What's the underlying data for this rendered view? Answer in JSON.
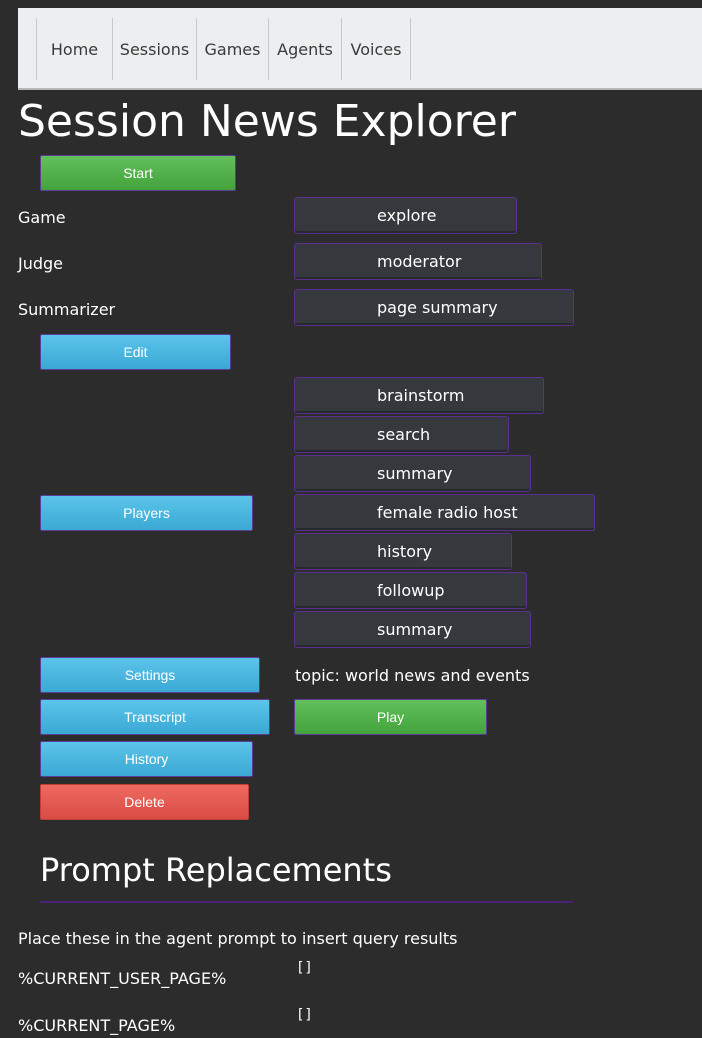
{
  "nav": {
    "items": [
      "Home",
      "Sessions",
      "Games",
      "Agents",
      "Voices"
    ]
  },
  "page_title": "Session News Explorer",
  "buttons": {
    "start": "Start",
    "edit": "Edit",
    "players": "Players",
    "settings": "Settings",
    "transcript": "Transcript",
    "history": "History",
    "delete": "Delete",
    "play": "Play"
  },
  "fields": {
    "game_label": "Game",
    "game_value": "explore",
    "judge_label": "Judge",
    "judge_value": "moderator",
    "summarizer_label": "Summarizer",
    "summarizer_value": "page summary"
  },
  "players": [
    "brainstorm",
    "search",
    "summary",
    "female radio host",
    "history",
    "followup",
    "summary"
  ],
  "settings_text": "topic: world news and events",
  "prompt_replacements": {
    "title": "Prompt Replacements",
    "description": "Place these in the agent prompt to insert query results",
    "items": [
      {
        "key": "%CURRENT_USER_PAGE%",
        "value": "[]"
      },
      {
        "key": "%CURRENT_PAGE%",
        "value": "[]"
      }
    ]
  },
  "colors": {
    "background": "#2c2c2c",
    "green": "#4fb447",
    "blue": "#45b4de",
    "red": "#e05a52",
    "purple_border": "#5a2f8f"
  }
}
